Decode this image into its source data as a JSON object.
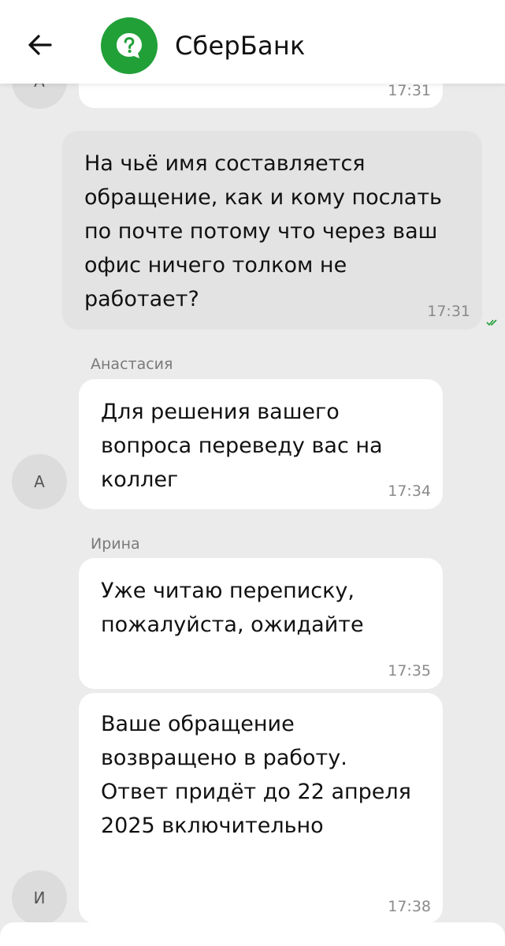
{
  "header": {
    "title": "СберБанк",
    "back_icon": "arrow-left-icon",
    "logo_icon": "question-chat-icon",
    "brand_color": "#21a038"
  },
  "messages": [
    {
      "id": "partial",
      "direction": "incoming",
      "avatar_initial": "А",
      "text": "",
      "time": "17:31"
    },
    {
      "id": "user-question",
      "direction": "outgoing",
      "text": "На чьё имя составляется\nобращение, как и кому послать\nпо почте потому что через ваш\nофис ничего толком не\nработает?",
      "time": "17:31",
      "status_icon": "double-check-icon"
    },
    {
      "id": "anastasia-1",
      "direction": "incoming",
      "sender": "Анастасия",
      "avatar_initial": "А",
      "text": "Для решения вашего\nвопроса переведу вас на\nколлег",
      "time": "17:34"
    },
    {
      "id": "irina-1",
      "direction": "incoming",
      "sender": "Ирина",
      "text": "Уже читаю переписку,\nпожалуйста, ожидайте",
      "time": "17:35"
    },
    {
      "id": "irina-2",
      "direction": "incoming",
      "avatar_initial": "И",
      "text": "Ваше обращение\nвозвращено в работу.\nОтвет придёт до 22 апреля\n2025 включительно",
      "time": "17:38"
    }
  ]
}
